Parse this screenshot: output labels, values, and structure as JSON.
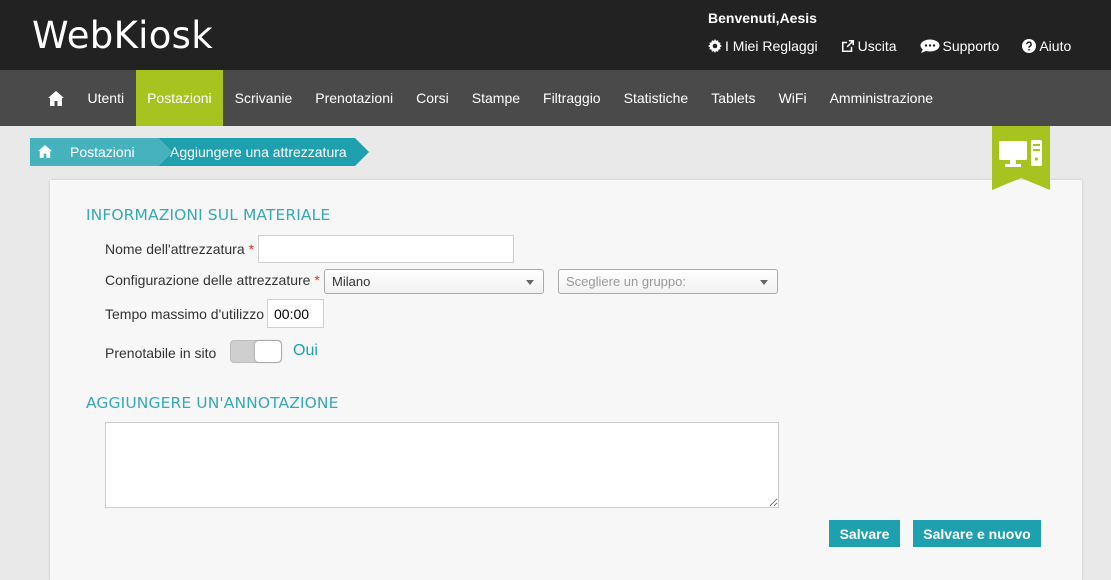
{
  "header": {
    "logo": "WebKiosk",
    "welcome": "Benvenuti,Aesis",
    "links": [
      {
        "label": "I Miei Reglaggi",
        "icon": "gear-icon"
      },
      {
        "label": "Uscita",
        "icon": "external-link-icon"
      },
      {
        "label": "Supporto",
        "icon": "chat-icon"
      },
      {
        "label": "Aiuto",
        "icon": "question-circle-icon"
      }
    ]
  },
  "nav": {
    "home_icon": "home-icon",
    "items": [
      "Utenti",
      "Postazioni",
      "Scrivanie",
      "Prenotazioni",
      "Corsi",
      "Stampe",
      "Filtraggio",
      "Statistiche",
      "Tablets",
      "WiFi",
      "Amministrazione"
    ],
    "active": "Postazioni"
  },
  "breadcrumb": {
    "items": [
      "Postazioni",
      "Aggiungere una attrezzatura"
    ]
  },
  "form": {
    "section1_title": "INFORMAZIONI SUL MATERIALE",
    "name_label": "Nome dell'attrezzatura",
    "required_mark": "*",
    "name_value": "",
    "config_label": "Configurazione delle attrezzature",
    "config_value": "Milano",
    "group_placeholder": "Scegliere un gruppo:",
    "max_time_label": "Tempo massimo d'utilizzo",
    "max_time_value": "00:00",
    "bookable_label": "Prenotabile in sito",
    "bookable_value": "Oui",
    "section2_title": "AGGIUNGERE UN'ANNOTAZIONE",
    "note_value": ""
  },
  "buttons": {
    "save": "Salvare",
    "save_new": "Salvare e nuovo"
  },
  "colors": {
    "accent": "#1fa0af",
    "nav_active": "#a6c31f",
    "header_bg": "#222222",
    "nav_bg": "#4a4a4a"
  }
}
